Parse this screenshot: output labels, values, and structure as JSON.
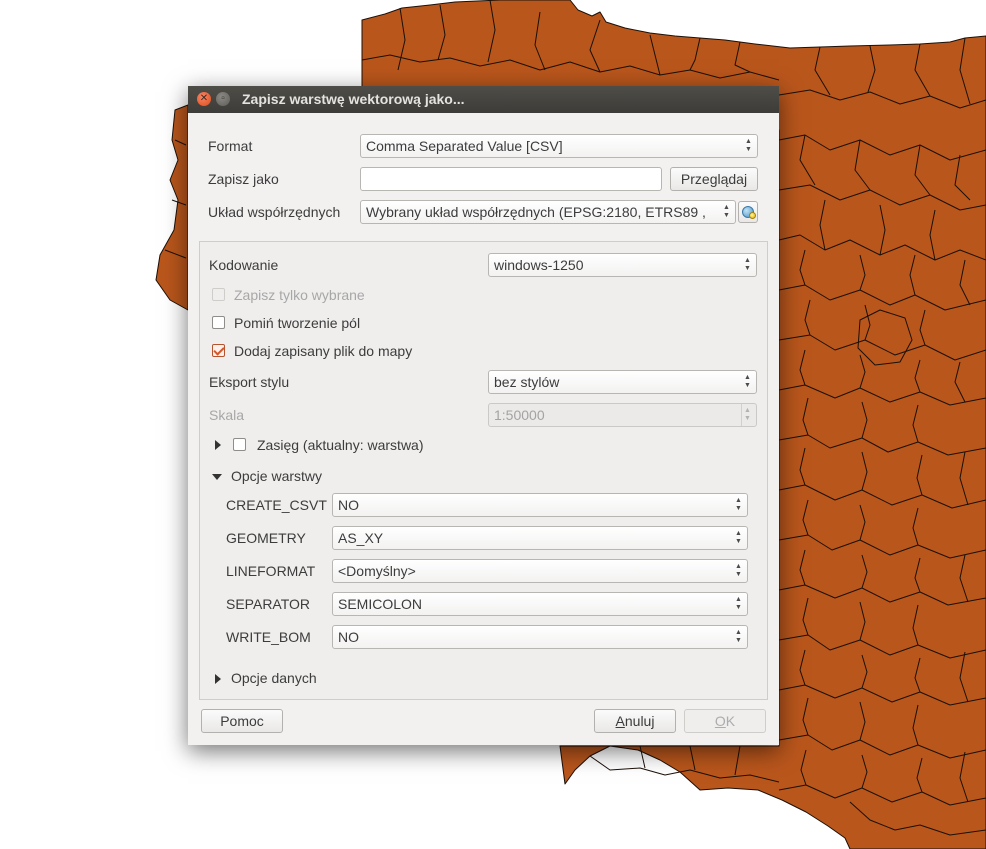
{
  "colors": {
    "map_fill": "#b9561c",
    "map_border": "#1c1008",
    "titlebar": "#45443f",
    "dialog_bg": "#f2f1f0",
    "accent": "#df4b16"
  },
  "window": {
    "title": "Zapisz warstwę wektorową jako...",
    "close_icon": "close-icon",
    "minimize_icon": "minimize-icon"
  },
  "form": {
    "format_label": "Format",
    "format_value": "Comma Separated Value [CSV]",
    "save_as_label": "Zapisz jako",
    "save_as_value": "",
    "browse_button": "Przeglądaj",
    "crs_label": "Układ współrzędnych",
    "crs_value": "Wybrany układ współrzędnych (EPSG:2180, ETRS89 ,",
    "crs_icon": "crs-selector-icon"
  },
  "options": {
    "encoding_label": "Kodowanie",
    "encoding_value": "windows-1250",
    "selected_only_label": "Zapisz tylko wybrane",
    "selected_only_checked": false,
    "skip_fields_label": "Pomiń tworzenie pól",
    "skip_fields_checked": false,
    "add_to_map_label": "Dodaj zapisany plik do mapy",
    "add_to_map_checked": true,
    "style_export_label": "Eksport stylu",
    "style_export_value": "bez stylów",
    "scale_label": "Skala",
    "scale_value": "1:50000",
    "extent_label": "Zasięg (aktualny: warstwa)",
    "extent_checked": false,
    "layer_options_label": "Opcje warstwy",
    "data_options_label": "Opcje danych"
  },
  "layer_options": [
    {
      "key": "CREATE_CSVT",
      "value": "NO"
    },
    {
      "key": "GEOMETRY",
      "value": "AS_XY"
    },
    {
      "key": "LINEFORMAT",
      "value": "<Domyślny>"
    },
    {
      "key": "SEPARATOR",
      "value": "SEMICOLON"
    },
    {
      "key": "WRITE_BOM",
      "value": "NO"
    }
  ],
  "footer": {
    "help_button": "Pomoc",
    "cancel_button_first": "A",
    "cancel_button_rest": "nuluj",
    "ok_button_first": "O",
    "ok_button_rest": "K"
  }
}
